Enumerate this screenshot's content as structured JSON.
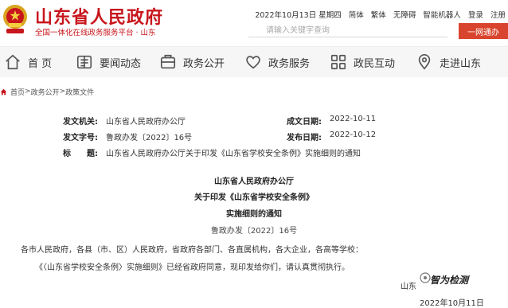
{
  "header": {
    "site_title": "山东省人民政府",
    "site_subtitle": "全国一体化在线政务服务平台 · 山东",
    "date": "2022年10月13日 星期四",
    "links": [
      "简体",
      "繁体",
      "无障碍",
      "智能机器人",
      "登录",
      "注册"
    ],
    "search_placeholder": "请输入关键字查询",
    "onenet_button": "一网通办"
  },
  "nav": {
    "items": [
      {
        "label": "首 页",
        "icon": "home-icon"
      },
      {
        "label": "要闻动态",
        "icon": "news-icon"
      },
      {
        "label": "政务公开",
        "icon": "open-affairs-icon"
      },
      {
        "label": "政务服务",
        "icon": "heart-icon"
      },
      {
        "label": "政民互动",
        "icon": "interaction-icon"
      },
      {
        "label": "走进山东",
        "icon": "location-icon"
      }
    ]
  },
  "breadcrumb": {
    "items": [
      "首页",
      "政务公开",
      "政策文件"
    ],
    "separator": ">"
  },
  "meta": {
    "issuer_label": "发文机关:",
    "issuer_value": "山东省人民政府办公厅",
    "date_label": "成文日期:",
    "date_value": "2022-10-11",
    "docno_label": "发文字号:",
    "docno_value": "鲁政办发〔2022〕16号",
    "publish_label": "发布日期:",
    "publish_value": "2022-10-12",
    "title_label": "标　　题:",
    "title_value": "山东省人民政府办公厅关于印发《山东省学校安全条例》实施细则的通知"
  },
  "document": {
    "heading_1": "山东省人民政府办公厅",
    "heading_2": "关于印发《山东省学校安全条例》",
    "heading_3": "实施细则的通知",
    "doc_number": "鲁政办发〔2022〕16号",
    "addressees": "各市人民政府，各县（市、区）人民政府，省政府各部门、各直属机构，各大企业，各高等学校：",
    "body": "《〈山东省学校安全条例〉实施细则》已经省政府同意，现印发给你们，请认真贯彻执行。",
    "signature_org": "山东",
    "signature_date": "2022年10月11日"
  },
  "watermark": {
    "text": "智为检测"
  },
  "colors": {
    "brand_red": "#c8161d",
    "button_red": "#d9442e",
    "nav_bg": "#f6f6f6"
  }
}
